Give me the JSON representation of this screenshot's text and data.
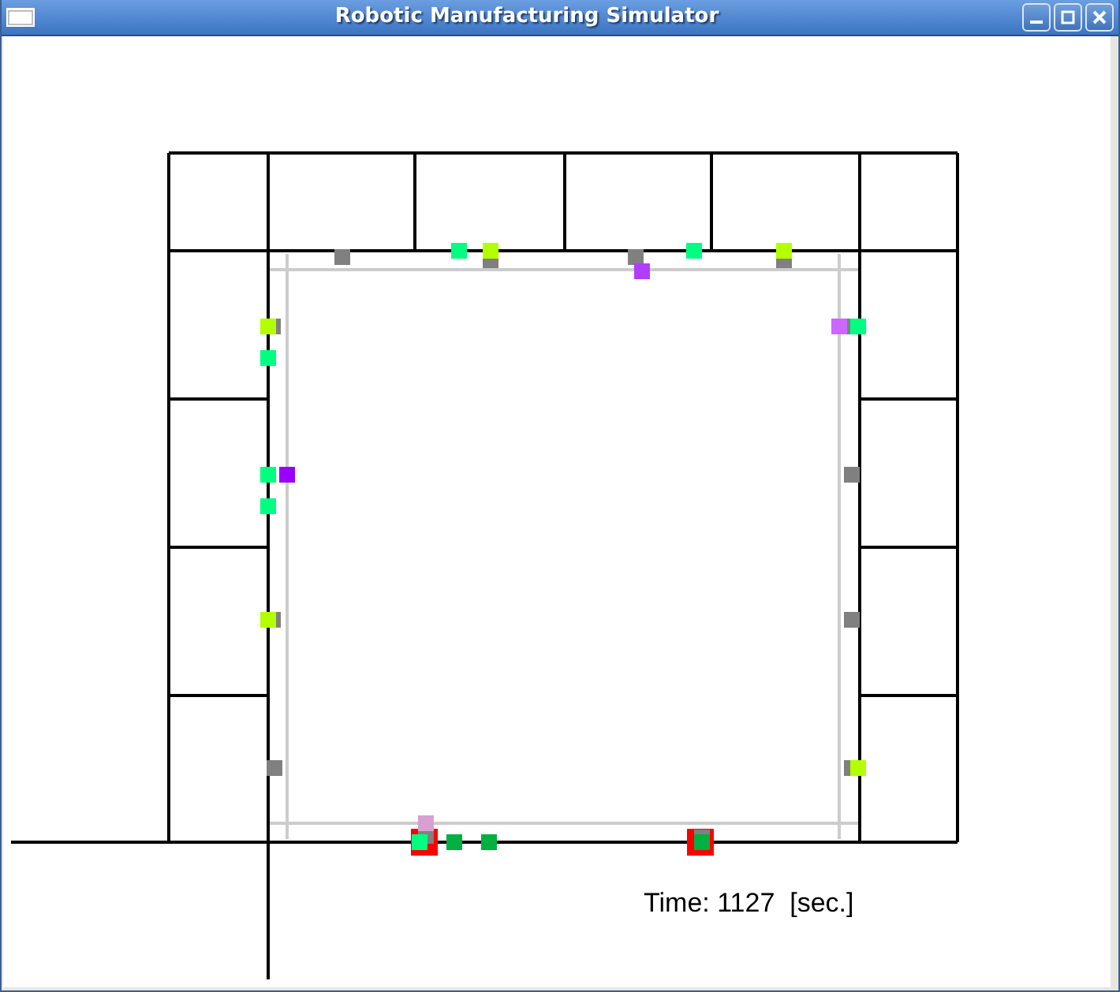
{
  "window": {
    "title": "Robotic Manufacturing Simulator"
  },
  "markers": [
    {
      "kind": "robot",
      "color": "#808080"
    },
    {
      "kind": "robot",
      "color": "#00ff80"
    },
    {
      "kind": "robot",
      "color": "#808080"
    },
    {
      "kind": "robot",
      "color": "#b3ff00"
    },
    {
      "kind": "robot",
      "color": "#808080"
    },
    {
      "kind": "robot",
      "color": "#b23cff"
    },
    {
      "kind": "robot",
      "color": "#00ff80"
    },
    {
      "kind": "robot",
      "color": "#808080"
    },
    {
      "kind": "robot",
      "color": "#b3ff00"
    },
    {
      "kind": "robot",
      "color": "#808080"
    },
    {
      "kind": "robot",
      "color": "#b3ff00"
    },
    {
      "kind": "robot",
      "color": "#00ff80"
    },
    {
      "kind": "robot",
      "color": "#00ff80"
    },
    {
      "kind": "robot",
      "color": "#9900ff"
    },
    {
      "kind": "robot",
      "color": "#00ff80"
    },
    {
      "kind": "robot",
      "color": "#808080"
    },
    {
      "kind": "robot",
      "color": "#b3ff00"
    },
    {
      "kind": "robot",
      "color": "#808080"
    },
    {
      "kind": "robot",
      "color": "#808080"
    },
    {
      "kind": "robot",
      "color": "#cc66ff"
    },
    {
      "kind": "robot",
      "color": "#00ff80"
    },
    {
      "kind": "robot",
      "color": "#808080"
    },
    {
      "kind": "robot",
      "color": "#808080"
    },
    {
      "kind": "robot",
      "color": "#808080"
    },
    {
      "kind": "robot",
      "color": "#b3ff00"
    },
    {
      "kind": "highlight",
      "color": "#ff0000"
    },
    {
      "kind": "robot",
      "color": "#808080"
    },
    {
      "kind": "robot",
      "color": "#d8a0d0"
    },
    {
      "kind": "robot",
      "color": "#00ff80"
    },
    {
      "kind": "robot",
      "color": "#00b040"
    },
    {
      "kind": "robot",
      "color": "#00b040"
    },
    {
      "kind": "highlight",
      "color": "#ff0000"
    },
    {
      "kind": "robot",
      "color": "#808080"
    },
    {
      "kind": "robot",
      "color": "#00b040"
    }
  ],
  "time_text": "Time: 1127  [sec.]"
}
